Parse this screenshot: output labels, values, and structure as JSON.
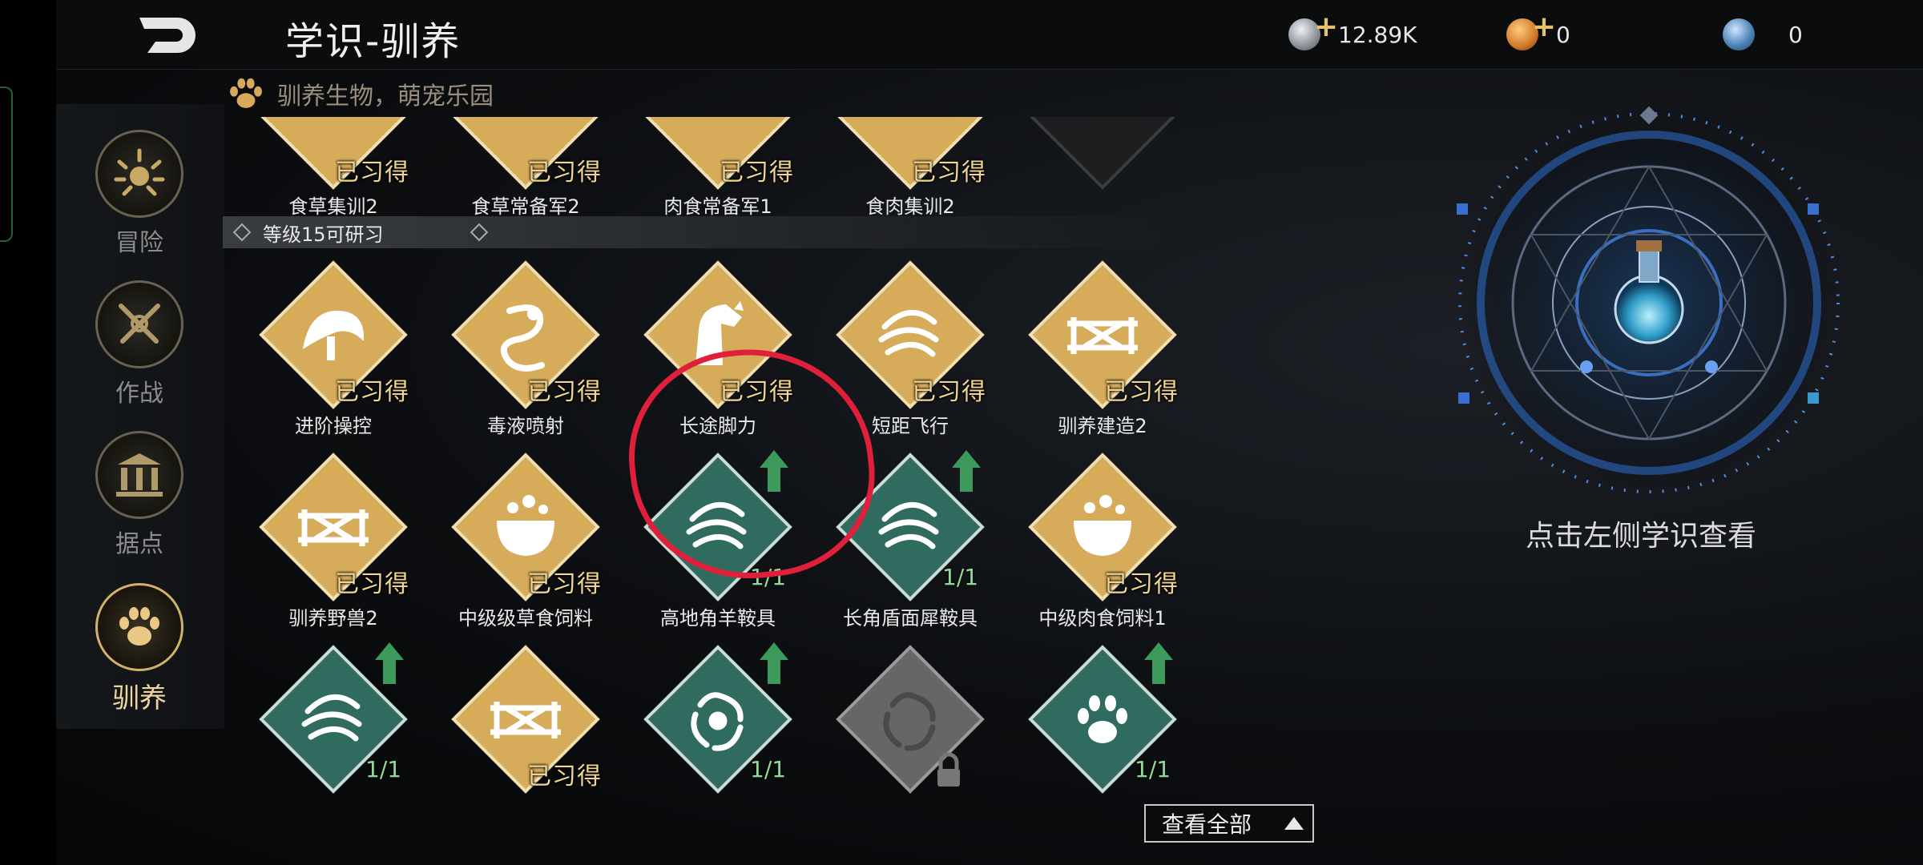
{
  "header": {
    "title": "学识-驯养",
    "back_icon": "back-arrow-icon",
    "resources": [
      {
        "name": "silver-coin-icon",
        "value": "12.89K",
        "has_plus": true,
        "color": "#b8bcc4"
      },
      {
        "name": "copper-coin-icon",
        "value": "0",
        "has_plus": true,
        "color": "#d88a3a"
      },
      {
        "name": "gem-orb-icon",
        "value": "0",
        "has_plus": false,
        "color": "#5f8fb8"
      }
    ]
  },
  "sidebar": {
    "items": [
      {
        "label": "冒险",
        "icon": "sun-emblem-icon",
        "active": false
      },
      {
        "label": "作战",
        "icon": "crossed-swords-icon",
        "active": false
      },
      {
        "label": "据点",
        "icon": "pillared-building-icon",
        "active": false
      },
      {
        "label": "驯养",
        "icon": "paw-print-icon",
        "active": true
      }
    ]
  },
  "subtitle": "驯养生物，萌宠乐园",
  "section": {
    "label": "等级15可研习"
  },
  "status_learned": "已习得",
  "top_row": [
    {
      "name": "食草集训2",
      "status": "已习得",
      "locked": false
    },
    {
      "name": "食草常备军2",
      "status": "已习得",
      "locked": false
    },
    {
      "name": "肉食常备军1",
      "status": "已习得",
      "locked": false
    },
    {
      "name": "食肉集训2",
      "status": "已习得",
      "locked": false
    },
    {
      "name": "",
      "status": "",
      "locked": true
    }
  ],
  "row1": [
    {
      "name": "进阶操控",
      "status": "已习得",
      "icon": "saddle-icon"
    },
    {
      "name": "毒液喷射",
      "status": "已习得",
      "icon": "serpent-icon"
    },
    {
      "name": "长途脚力",
      "status": "已习得",
      "icon": "horse-head-icon"
    },
    {
      "name": "短距飞行",
      "status": "已习得",
      "icon": "wind-swirl-icon"
    },
    {
      "name": "驯养建造2",
      "status": "已习得",
      "icon": "fence-icon"
    }
  ],
  "row2": [
    {
      "name": "驯养野兽2",
      "status": "已习得",
      "icon": "fence-icon",
      "kind": "gold"
    },
    {
      "name": "中级级草食饲料",
      "status": "已习得",
      "icon": "cauldron-icon",
      "kind": "gold"
    },
    {
      "name": "高地角羊鞍具",
      "count": "1/1",
      "icon": "wind-swirl-icon",
      "kind": "green",
      "upgrade": true
    },
    {
      "name": "长角盾面犀鞍具",
      "count": "1/1",
      "icon": "wind-swirl-icon",
      "kind": "green",
      "upgrade": true
    },
    {
      "name": "中级肉食饲料1",
      "status": "已习得",
      "icon": "cauldron-icon",
      "kind": "gold"
    }
  ],
  "row3": [
    {
      "count": "1/1",
      "icon": "wind-swirl-icon",
      "kind": "green",
      "upgrade": true
    },
    {
      "status": "已习得",
      "icon": "fence-icon",
      "kind": "gold"
    },
    {
      "count": "1/1",
      "icon": "vortex-icon",
      "kind": "green",
      "upgrade": true
    },
    {
      "icon": "vortex-icon",
      "kind": "grey",
      "locked": true
    },
    {
      "count": "1/1",
      "icon": "paw-claw-icon",
      "kind": "green",
      "upgrade": true
    }
  ],
  "view_all": {
    "label": "查看全部"
  },
  "right_panel": {
    "hint": "点击左侧学识查看",
    "center_icon": "potion-flask-icon"
  },
  "colors": {
    "gold": "#d9ae5c",
    "green": "#2e6a5e",
    "grey": "#6a6a6a",
    "highlight_circle": "#e0203a"
  }
}
